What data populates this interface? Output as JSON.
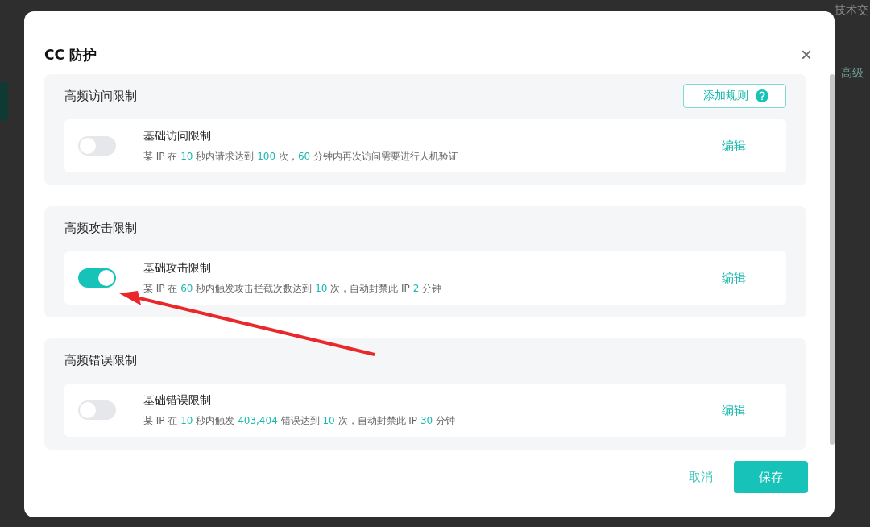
{
  "backdrop": {
    "top_right_link": "技术交",
    "side_tab": "高级"
  },
  "dialog": {
    "title": "CC 防护",
    "close": "×",
    "sections": [
      {
        "title": "高频访问限制",
        "add_button": "添加规则",
        "rules": [
          {
            "enabled": false,
            "name": "基础访问限制",
            "edit": "编辑",
            "description": [
              {
                "text": "某 IP 在 ",
                "highlight": false
              },
              {
                "text": "10",
                "highlight": true
              },
              {
                "text": " 秒内请求达到 ",
                "highlight": false
              },
              {
                "text": "100",
                "highlight": true
              },
              {
                "text": " 次，",
                "highlight": false
              },
              {
                "text": "60",
                "highlight": true
              },
              {
                "text": " 分钟内再次访问需要进行人机验证",
                "highlight": false
              }
            ]
          }
        ]
      },
      {
        "title": "高频攻击限制",
        "rules": [
          {
            "enabled": true,
            "name": "基础攻击限制",
            "edit": "编辑",
            "description": [
              {
                "text": "某 IP 在 ",
                "highlight": false
              },
              {
                "text": "60",
                "highlight": true
              },
              {
                "text": " 秒内触发攻击拦截次数达到 ",
                "highlight": false
              },
              {
                "text": "10",
                "highlight": true
              },
              {
                "text": " 次，自动封禁此 IP ",
                "highlight": false
              },
              {
                "text": "2",
                "highlight": true
              },
              {
                "text": " 分钟",
                "highlight": false
              }
            ]
          }
        ]
      },
      {
        "title": "高频错误限制",
        "rules": [
          {
            "enabled": false,
            "name": "基础错误限制",
            "edit": "编辑",
            "description": [
              {
                "text": "某 IP 在 ",
                "highlight": false
              },
              {
                "text": "10",
                "highlight": true
              },
              {
                "text": " 秒内触发 ",
                "highlight": false
              },
              {
                "text": "403,404",
                "highlight": true
              },
              {
                "text": " 错误达到 ",
                "highlight": false
              },
              {
                "text": "10",
                "highlight": true
              },
              {
                "text": " 次，自动封禁此 IP ",
                "highlight": false
              },
              {
                "text": "30",
                "highlight": true
              },
              {
                "text": " 分钟",
                "highlight": false
              }
            ]
          }
        ]
      }
    ],
    "cancel": "取消",
    "save": "保存"
  }
}
